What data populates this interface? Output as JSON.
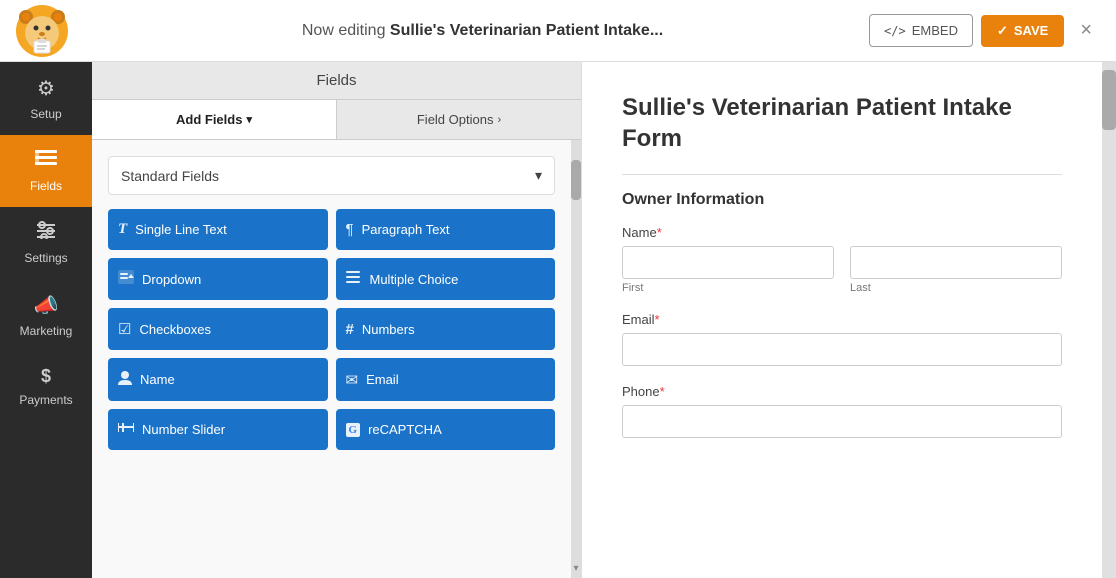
{
  "topbar": {
    "editing_prefix": "Now editing ",
    "form_name": "Sullie's Veterinarian Patient Intake...",
    "embed_label": "EMBED",
    "save_label": "SAVE",
    "close_label": "×"
  },
  "left_nav": {
    "items": [
      {
        "id": "setup",
        "label": "Setup",
        "icon": "⚙",
        "active": false
      },
      {
        "id": "fields",
        "label": "Fields",
        "icon": "☰",
        "active": true
      },
      {
        "id": "settings",
        "label": "Settings",
        "icon": "≡",
        "active": false
      },
      {
        "id": "marketing",
        "label": "Marketing",
        "icon": "📣",
        "active": false
      },
      {
        "id": "payments",
        "label": "Payments",
        "icon": "$",
        "active": false
      }
    ]
  },
  "center_panel": {
    "header_label": "Fields",
    "tab_add_fields": "Add Fields",
    "tab_field_options": "Field Options",
    "standard_fields_label": "Standard Fields",
    "field_buttons": [
      {
        "id": "single-line-text",
        "label": "Single Line Text",
        "icon": "T"
      },
      {
        "id": "paragraph-text",
        "label": "Paragraph Text",
        "icon": "¶"
      },
      {
        "id": "dropdown",
        "label": "Dropdown",
        "icon": "▤"
      },
      {
        "id": "multiple-choice",
        "label": "Multiple Choice",
        "icon": "☰"
      },
      {
        "id": "checkboxes",
        "label": "Checkboxes",
        "icon": "☑"
      },
      {
        "id": "numbers",
        "label": "Numbers",
        "icon": "#"
      },
      {
        "id": "name",
        "label": "Name",
        "icon": "👤"
      },
      {
        "id": "email",
        "label": "Email",
        "icon": "✉"
      },
      {
        "id": "number-slider",
        "label": "Number Slider",
        "icon": "⊟"
      },
      {
        "id": "recaptcha",
        "label": "reCAPTCHA",
        "icon": "G"
      }
    ]
  },
  "form_preview": {
    "title": "Sullie's Veterinarian Patient Intake Form",
    "section_owner": "Owner Information",
    "fields": [
      {
        "id": "name",
        "label": "Name",
        "required": true,
        "type": "name",
        "sub_labels": [
          "First",
          "Last"
        ]
      },
      {
        "id": "email",
        "label": "Email",
        "required": true,
        "type": "text"
      },
      {
        "id": "phone",
        "label": "Phone",
        "required": true,
        "type": "text"
      }
    ]
  }
}
